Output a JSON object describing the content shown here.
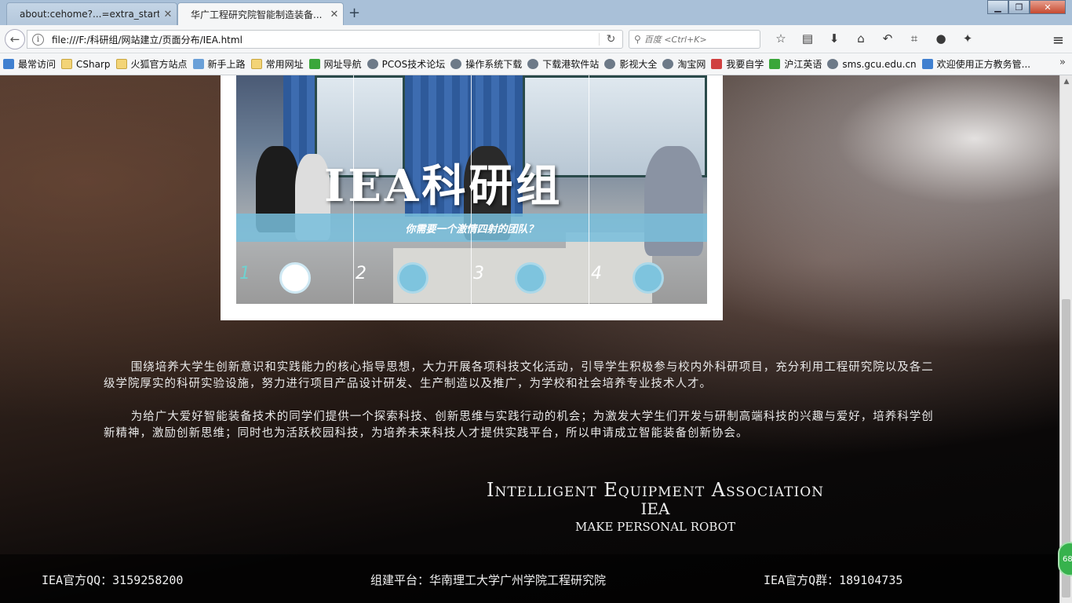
{
  "browser": {
    "tabs": [
      {
        "title": "about:cehome?...=extra_start",
        "active": false
      },
      {
        "title": "华广工程研究院智能制造装备...",
        "active": true
      }
    ],
    "url": "file:///F:/科研组/网站建立/页面分布/IEA.html",
    "search_placeholder": "百度 <Ctrl+K>",
    "bookmarks": [
      {
        "label": "最常访问",
        "icon": "blue"
      },
      {
        "label": "CSharp",
        "icon": "folder"
      },
      {
        "label": "火狐官方站点",
        "icon": "folder"
      },
      {
        "label": "新手上路",
        "icon": "img"
      },
      {
        "label": "常用网址",
        "icon": "folder"
      },
      {
        "label": "网址导航",
        "icon": "green"
      },
      {
        "label": "PCOS技术论坛",
        "icon": "globe"
      },
      {
        "label": "操作系统下载",
        "icon": "globe"
      },
      {
        "label": "下载港软件站",
        "icon": "globe"
      },
      {
        "label": "影视大全",
        "icon": "globe"
      },
      {
        "label": "淘宝网",
        "icon": "globe"
      },
      {
        "label": "我要自学",
        "icon": "red"
      },
      {
        "label": "沪江英语",
        "icon": "green"
      },
      {
        "label": "sms.gcu.edu.cn",
        "icon": "globe"
      },
      {
        "label": "欢迎使用正方教务管...",
        "icon": "blue"
      }
    ],
    "badge_count": "68"
  },
  "banner": {
    "title": "IEA科研组",
    "slogan": "你需要一个激情四射的团队？",
    "slides": [
      "1",
      "2",
      "3",
      "4"
    ],
    "active_slide": 0
  },
  "intro": {
    "p1": "围绕培养大学生创新意识和实践能力的核心指导思想，大力开展各项科技文化活动，引导学生积极参与校内外科研项目，充分利用工程研究院以及各二级学院厚实的科研实验设施，努力进行项目产品设计研发、生产制造以及推广，为学校和社会培养专业技术人才。",
    "p2": "为给广大爱好智能装备技术的同学们提供一个探索科技、创新思维与实践行动的机会；为激发大学生们开发与研制高端科技的兴趣与爱好，培养科学创新精神，激励创新思维；同时也为活跃校园科技，为培养未来科技人才提供实践平台，所以申请成立智能装备创新协会。"
  },
  "association": {
    "name": "Intelligent Equipment Association",
    "abbr": "IEA",
    "motto": "MAKE PERSONAL ROBOT"
  },
  "footer": {
    "qq": "IEA官方QQ：3159258200",
    "platform": "组建平台：华南理工大学广州学院工程研究院",
    "group": "IEA官方Q群：189104735"
  }
}
